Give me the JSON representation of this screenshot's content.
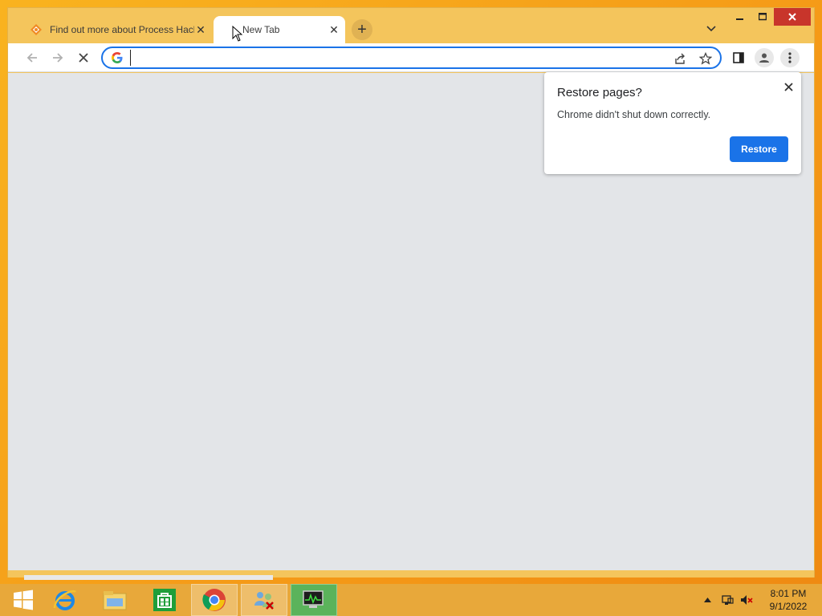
{
  "browser": {
    "tabs": [
      {
        "title": "Find out more about Process Hacker",
        "favicon": "process-hacker-icon"
      },
      {
        "title": "New Tab",
        "favicon": "loading-icon"
      }
    ],
    "omnibox": {
      "value": "",
      "placeholder": ""
    },
    "colors": {
      "accent": "#1a73e8",
      "titlebar": "#f4c55c",
      "content": "#e3e5e8"
    }
  },
  "restore_bubble": {
    "title": "Restore pages?",
    "message": "Chrome didn't shut down correctly.",
    "button_label": "Restore"
  },
  "taskbar": {
    "apps": [
      "start-icon",
      "internet-explorer-icon",
      "file-explorer-icon",
      "store-icon",
      "chrome-icon",
      "network-users-icon",
      "process-monitor-icon"
    ],
    "clock": {
      "time": "8:01 PM",
      "date": "9/1/2022"
    }
  }
}
